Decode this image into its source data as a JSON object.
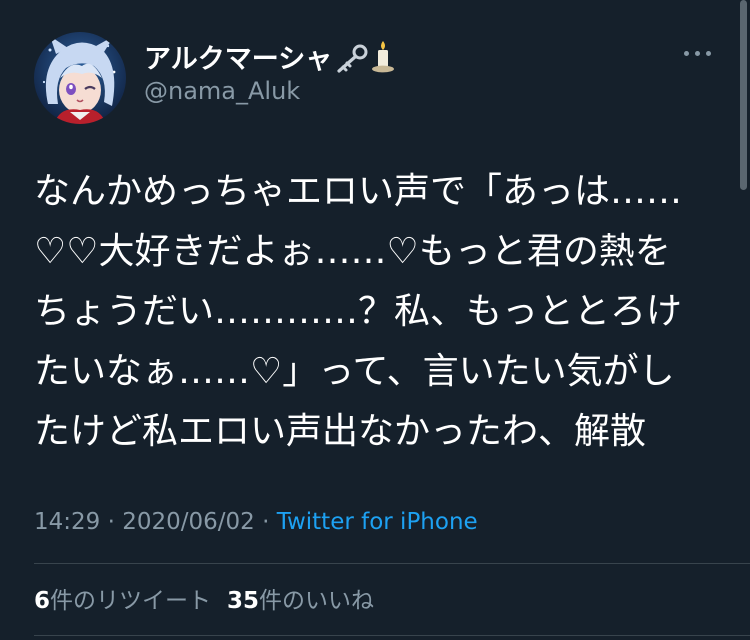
{
  "user": {
    "display_name": "アルクマーシャ",
    "name_emojis": [
      "key-emoji",
      "candle-emoji"
    ],
    "handle": "@nama_Aluk"
  },
  "tweet": {
    "lines": [
      "なんかめっちゃエロい声で「あっは……",
      "♡♡大好きだよぉ……♡もっと君の熱を",
      "ちょうだい…………？私、もっととろけ",
      "たいなぁ……♡」って、言いたい気がし",
      "たけど私エロい声出なかったわ、解散"
    ]
  },
  "meta": {
    "timestamp": "14:29 · 2020/06/02 · ",
    "source": "Twitter for iPhone"
  },
  "stats": {
    "retweets_count": "6",
    "retweets_label": "件のリツイート",
    "likes_count": "35",
    "likes_label": "件のいいね"
  },
  "colors": {
    "background": "#15202b",
    "secondary_text": "#8899a6",
    "link": "#1da1f2",
    "divider": "#38444d"
  }
}
